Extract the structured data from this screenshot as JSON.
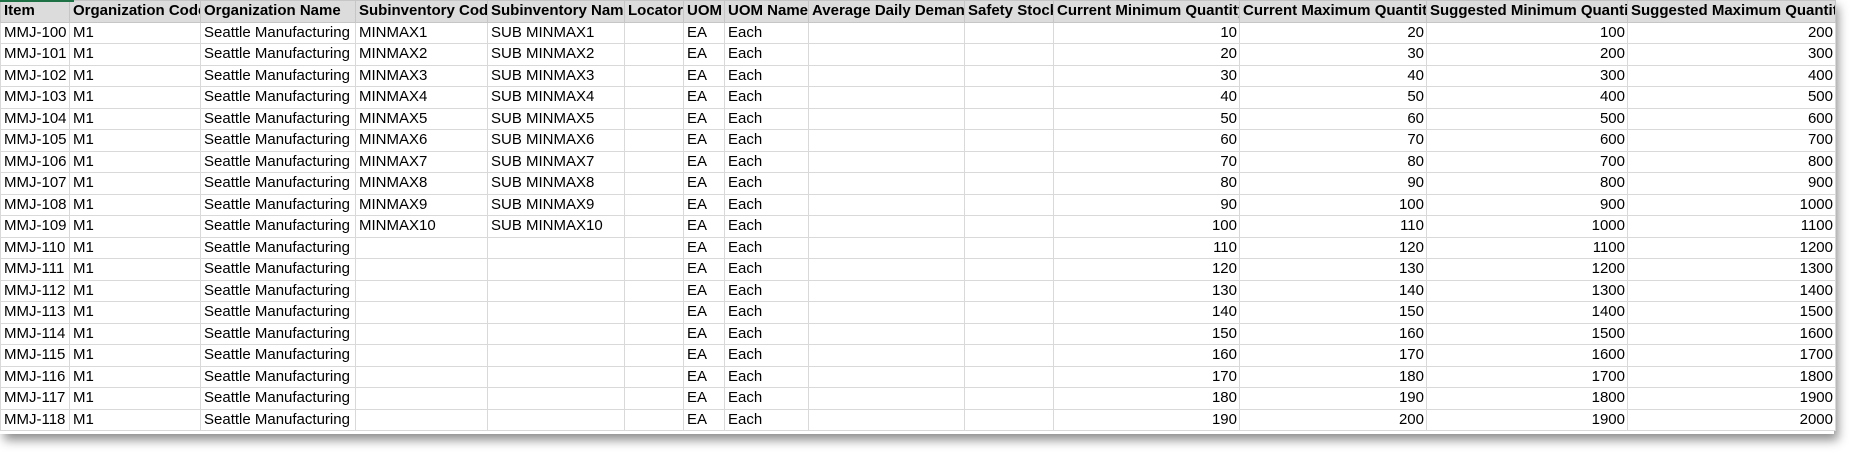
{
  "columns": [
    "Item",
    "Organization Code",
    "Organization Name",
    "Subinventory Code",
    "Subinventory Name",
    "Locator",
    "UOM",
    "UOM Name",
    "Average Daily Demand",
    "Safety Stock",
    "Current Minimum Quantity",
    "Current Maximum Quantity",
    "Suggested Minimum Quantity",
    "Suggested Maximum Quantity"
  ],
  "rows": [
    [
      "MMJ-100",
      "M1",
      "Seattle Manufacturing",
      "MINMAX1",
      "SUB MINMAX1",
      "",
      "EA",
      "Each",
      "",
      "",
      "10",
      "20",
      "100",
      "200"
    ],
    [
      "MMJ-101",
      "M1",
      "Seattle Manufacturing",
      "MINMAX2",
      "SUB MINMAX2",
      "",
      "EA",
      "Each",
      "",
      "",
      "20",
      "30",
      "200",
      "300"
    ],
    [
      "MMJ-102",
      "M1",
      "Seattle Manufacturing",
      "MINMAX3",
      "SUB MINMAX3",
      "",
      "EA",
      "Each",
      "",
      "",
      "30",
      "40",
      "300",
      "400"
    ],
    [
      "MMJ-103",
      "M1",
      "Seattle Manufacturing",
      "MINMAX4",
      "SUB MINMAX4",
      "",
      "EA",
      "Each",
      "",
      "",
      "40",
      "50",
      "400",
      "500"
    ],
    [
      "MMJ-104",
      "M1",
      "Seattle Manufacturing",
      "MINMAX5",
      "SUB MINMAX5",
      "",
      "EA",
      "Each",
      "",
      "",
      "50",
      "60",
      "500",
      "600"
    ],
    [
      "MMJ-105",
      "M1",
      "Seattle Manufacturing",
      "MINMAX6",
      "SUB MINMAX6",
      "",
      "EA",
      "Each",
      "",
      "",
      "60",
      "70",
      "600",
      "700"
    ],
    [
      "MMJ-106",
      "M1",
      "Seattle Manufacturing",
      "MINMAX7",
      "SUB MINMAX7",
      "",
      "EA",
      "Each",
      "",
      "",
      "70",
      "80",
      "700",
      "800"
    ],
    [
      "MMJ-107",
      "M1",
      "Seattle Manufacturing",
      "MINMAX8",
      "SUB MINMAX8",
      "",
      "EA",
      "Each",
      "",
      "",
      "80",
      "90",
      "800",
      "900"
    ],
    [
      "MMJ-108",
      "M1",
      "Seattle Manufacturing",
      "MINMAX9",
      "SUB MINMAX9",
      "",
      "EA",
      "Each",
      "",
      "",
      "90",
      "100",
      "900",
      "1000"
    ],
    [
      "MMJ-109",
      "M1",
      "Seattle Manufacturing",
      "MINMAX10",
      "SUB MINMAX10",
      "",
      "EA",
      "Each",
      "",
      "",
      "100",
      "110",
      "1000",
      "1100"
    ],
    [
      "MMJ-110",
      "M1",
      "Seattle Manufacturing",
      "",
      "",
      "",
      "EA",
      "Each",
      "",
      "",
      "110",
      "120",
      "1100",
      "1200"
    ],
    [
      "MMJ-111",
      "M1",
      "Seattle Manufacturing",
      "",
      "",
      "",
      "EA",
      "Each",
      "",
      "",
      "120",
      "130",
      "1200",
      "1300"
    ],
    [
      "MMJ-112",
      "M1",
      "Seattle Manufacturing",
      "",
      "",
      "",
      "EA",
      "Each",
      "",
      "",
      "130",
      "140",
      "1300",
      "1400"
    ],
    [
      "MMJ-113",
      "M1",
      "Seattle Manufacturing",
      "",
      "",
      "",
      "EA",
      "Each",
      "",
      "",
      "140",
      "150",
      "1400",
      "1500"
    ],
    [
      "MMJ-114",
      "M1",
      "Seattle Manufacturing",
      "",
      "",
      "",
      "EA",
      "Each",
      "",
      "",
      "150",
      "160",
      "1500",
      "1600"
    ],
    [
      "MMJ-115",
      "M1",
      "Seattle Manufacturing",
      "",
      "",
      "",
      "EA",
      "Each",
      "",
      "",
      "160",
      "170",
      "1600",
      "1700"
    ],
    [
      "MMJ-116",
      "M1",
      "Seattle Manufacturing",
      "",
      "",
      "",
      "EA",
      "Each",
      "",
      "",
      "170",
      "180",
      "1700",
      "1800"
    ],
    [
      "MMJ-117",
      "M1",
      "Seattle Manufacturing",
      "",
      "",
      "",
      "EA",
      "Each",
      "",
      "",
      "180",
      "190",
      "1800",
      "1900"
    ],
    [
      "MMJ-118",
      "M1",
      "Seattle Manufacturing",
      "",
      "",
      "",
      "EA",
      "Each",
      "",
      "",
      "190",
      "200",
      "1900",
      "2000"
    ]
  ]
}
